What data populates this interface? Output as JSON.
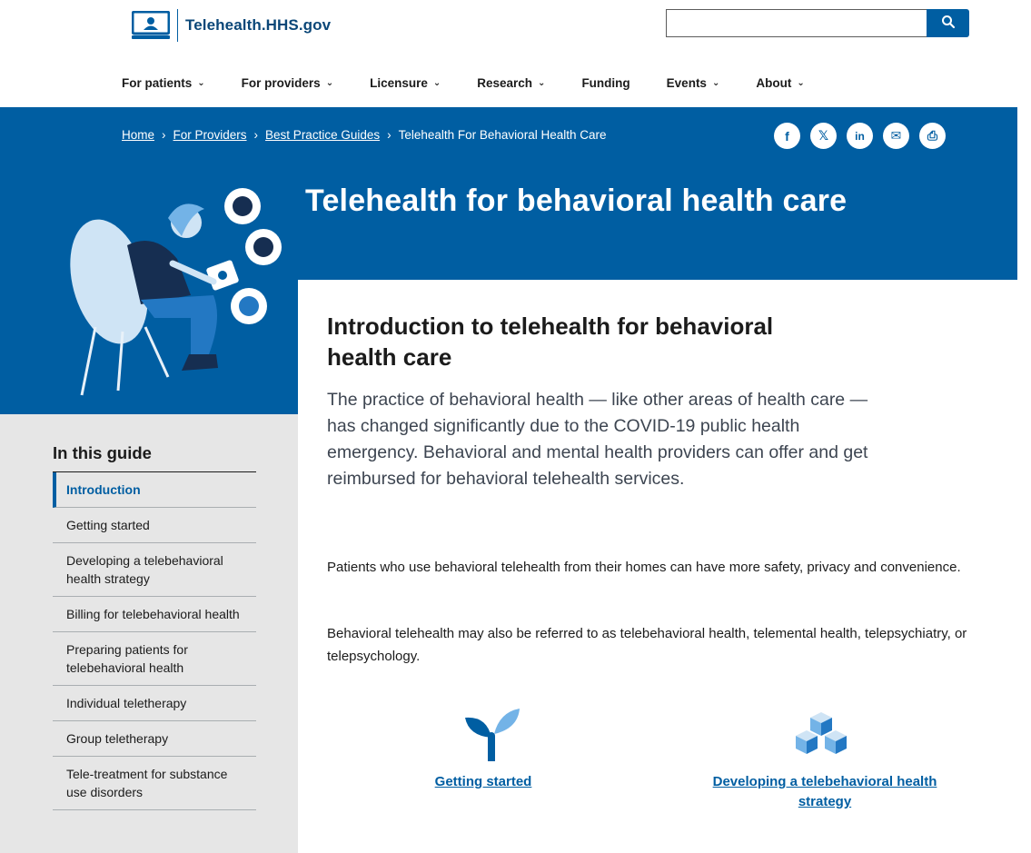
{
  "site": {
    "logo_text": "Telehealth.HHS.gov",
    "logo_icon": "telehealth-monitor-logo",
    "search_placeholder": "",
    "search_icon": "search-icon"
  },
  "nav": {
    "items": [
      {
        "label": "For patients",
        "has_dropdown": true,
        "active": false
      },
      {
        "label": "For providers",
        "has_dropdown": true,
        "active": true
      },
      {
        "label": "Licensure",
        "has_dropdown": true,
        "active": false
      },
      {
        "label": "Research",
        "has_dropdown": true,
        "active": false
      },
      {
        "label": "Funding",
        "has_dropdown": false,
        "active": false
      },
      {
        "label": "Events",
        "has_dropdown": true,
        "active": false
      },
      {
        "label": "About",
        "has_dropdown": true,
        "active": false
      }
    ],
    "chevron": "⌄"
  },
  "breadcrumb": {
    "items": [
      "Home",
      "For Providers",
      "Best Practice Guides"
    ],
    "current": "Telehealth For Behavioral Health Care",
    "separator": "›"
  },
  "share": {
    "facebook": "f",
    "x": "𝕏",
    "linkedin": "in",
    "email": "✉",
    "print": "⎙"
  },
  "hero": {
    "title": "Telehealth for behavioral health care"
  },
  "content": {
    "heading": "Introduction to telehealth for behavioral health care",
    "lead": "The practice of behavioral health — like other areas of health care — has changed significantly due to the COVID-19 public health emergency. Behavioral and mental health providers can offer and get reimbursed for behavioral telehealth services.",
    "p1": "Patients who use behavioral telehealth from their homes can have more safety, privacy and convenience.",
    "p2": "Behavioral telehealth may also be referred to as telebehavioral health, telemental health, telepsychiatry, or telepsychology.",
    "cards": [
      {
        "label": "Getting started",
        "icon": "sprout-icon"
      },
      {
        "label": "Developing a telebehavioral health strategy",
        "icon": "stacked-blocks-icon"
      }
    ]
  },
  "sidebar": {
    "title": "In this guide",
    "items": [
      {
        "label": "Introduction",
        "current": true
      },
      {
        "label": "Getting started",
        "current": false
      },
      {
        "label": "Developing a telebehavioral health strategy",
        "current": false
      },
      {
        "label": "Billing for telebehavioral health",
        "current": false
      },
      {
        "label": "Preparing patients for telebehavioral health",
        "current": false
      },
      {
        "label": "Individual teletherapy",
        "current": false
      },
      {
        "label": "Group teletherapy",
        "current": false
      },
      {
        "label": "Tele-treatment for substance use disorders",
        "current": false
      }
    ]
  },
  "colors": {
    "primary": "#005ea2",
    "dark_blue": "#0b4778",
    "sidebar_bg": "#e6e6e6",
    "text": "#1b1b1b"
  }
}
